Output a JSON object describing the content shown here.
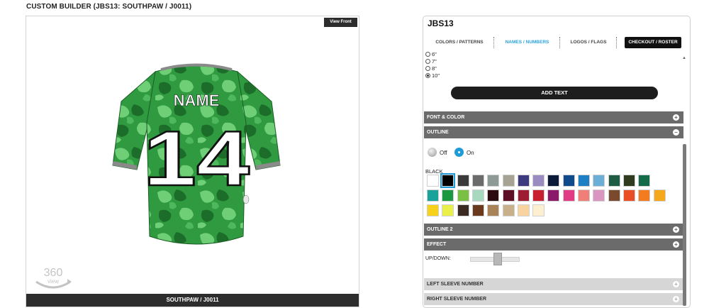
{
  "page": {
    "title": "CUSTOM BUILDER (JBS13: SOUTHPAW / J0011)"
  },
  "preview": {
    "view_button": "View Front",
    "jersey": {
      "name_text": "NAME",
      "number_text": "14",
      "colors": {
        "base": "#2f9a3f",
        "camo_light": "#6fcf77",
        "camo_dark": "#1d6d2a",
        "trim": "#8a8a8a"
      }
    },
    "view360_label": "360",
    "view360_sublabel": "view",
    "footer": "SOUTHPAW / J0011"
  },
  "panel": {
    "title": "JBS13",
    "tabs": [
      {
        "label": "COLORS / PATTERNS",
        "active": false
      },
      {
        "label": "NAMES / NUMBERS",
        "active": true
      },
      {
        "label": "LOGOS / FLAGS",
        "active": false
      },
      {
        "label": "CHECKOUT / ROSTER",
        "active": false
      }
    ],
    "size_options": [
      {
        "label": "6\"",
        "selected": false
      },
      {
        "label": "7\"",
        "selected": false
      },
      {
        "label": "8\"",
        "selected": false
      },
      {
        "label": "10\"",
        "selected": true
      }
    ],
    "add_text_button": "ADD TEXT",
    "sections": {
      "font_color": "FONT & COLOR",
      "outline": "OUTLINE",
      "outline2": "OUTLINE 2",
      "effect": "EFFECT",
      "left_sleeve": "LEFT SLEEVE NUMBER",
      "right_sleeve": "RIGHT SLEEVE NUMBER"
    },
    "outline": {
      "off_label": "Off",
      "on_label": "On",
      "state": "On",
      "selected_color_name": "BLACK",
      "swatches": [
        "#ffffff",
        "#000000",
        "#3a3a3a",
        "#6b6b6b",
        "#8d9a95",
        "#a7a394",
        "#3d3a80",
        "#9a8cc0",
        "#0c1a3a",
        "#0f4a8a",
        "#1f7fc4",
        "#6baed6",
        "#1e5c44",
        "#2e3b1f",
        "#136b4a",
        "#17a39a",
        "#1c9940",
        "#7ac143",
        "#a8d8c0",
        "#2b0a10",
        "#5e0f25",
        "#9e1b34",
        "#c8202f",
        "#8b1a6b",
        "#e23b86",
        "#f07f7a",
        "#d996c0",
        "#7a4a2e",
        "#e94e24",
        "#f37b20",
        "#f6a81c",
        "#f7d11a",
        "#e9f04a",
        "#3a2a22",
        "#6b3a1e",
        "#a88458",
        "#c8b08a",
        "#f8d3a0",
        "#fdf0d0"
      ],
      "selected_swatch_index": 1
    },
    "effect": {
      "slider_label": "UP/DOWN:",
      "slider_value": 0.55
    }
  }
}
